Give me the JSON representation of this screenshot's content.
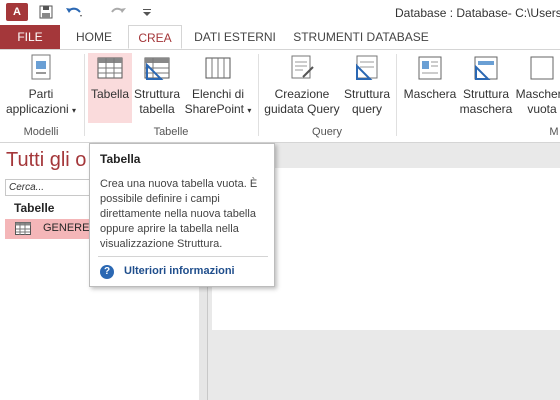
{
  "titlebar": {
    "app_icon": "A",
    "window_title": "Database : Database- C:\\Users\\"
  },
  "tabs": [
    {
      "label": "FILE"
    },
    {
      "label": "HOME"
    },
    {
      "label": "CREA"
    },
    {
      "label": "DATI ESTERNI"
    },
    {
      "label": "STRUMENTI DATABASE"
    }
  ],
  "ribbon": {
    "parti_line1": "Parti",
    "parti_line2": "applicazioni",
    "tabella": "Tabella",
    "struttura_tabella_1": "Struttura",
    "struttura_tabella_2": "tabella",
    "elenchi_1": "Elenchi di",
    "elenchi_2": "SharePoint",
    "creazione_1": "Creazione",
    "creazione_2": "guidata Query",
    "struttura_query_1": "Struttura",
    "struttura_query_2": "query",
    "maschera": "Maschera",
    "struttura_maschera_1": "Struttura",
    "struttura_maschera_2": "maschera",
    "maschera_vuota_1": "Maschera",
    "maschera_vuota_2": "vuota",
    "group_modelli": "Modelli",
    "group_tabelle": "Tabelle",
    "group_query": "Query",
    "group_maschere": "M"
  },
  "nav": {
    "title": "Tutti gli o",
    "search_placeholder": "Cerca...",
    "section": "Tabelle",
    "items": [
      {
        "label": "GENERE"
      }
    ]
  },
  "tooltip": {
    "title": "Tabella",
    "body": "Crea una nuova tabella vuota. È possibile definire i campi direttamente nella nuova tabella oppure aprire la tabella nella visualizzazione Struttura.",
    "link": "Ulteriori informazioni"
  },
  "colors": {
    "accent": "#a4373a",
    "selected_item": "#f4b6b8",
    "link": "#1f4e8c"
  }
}
